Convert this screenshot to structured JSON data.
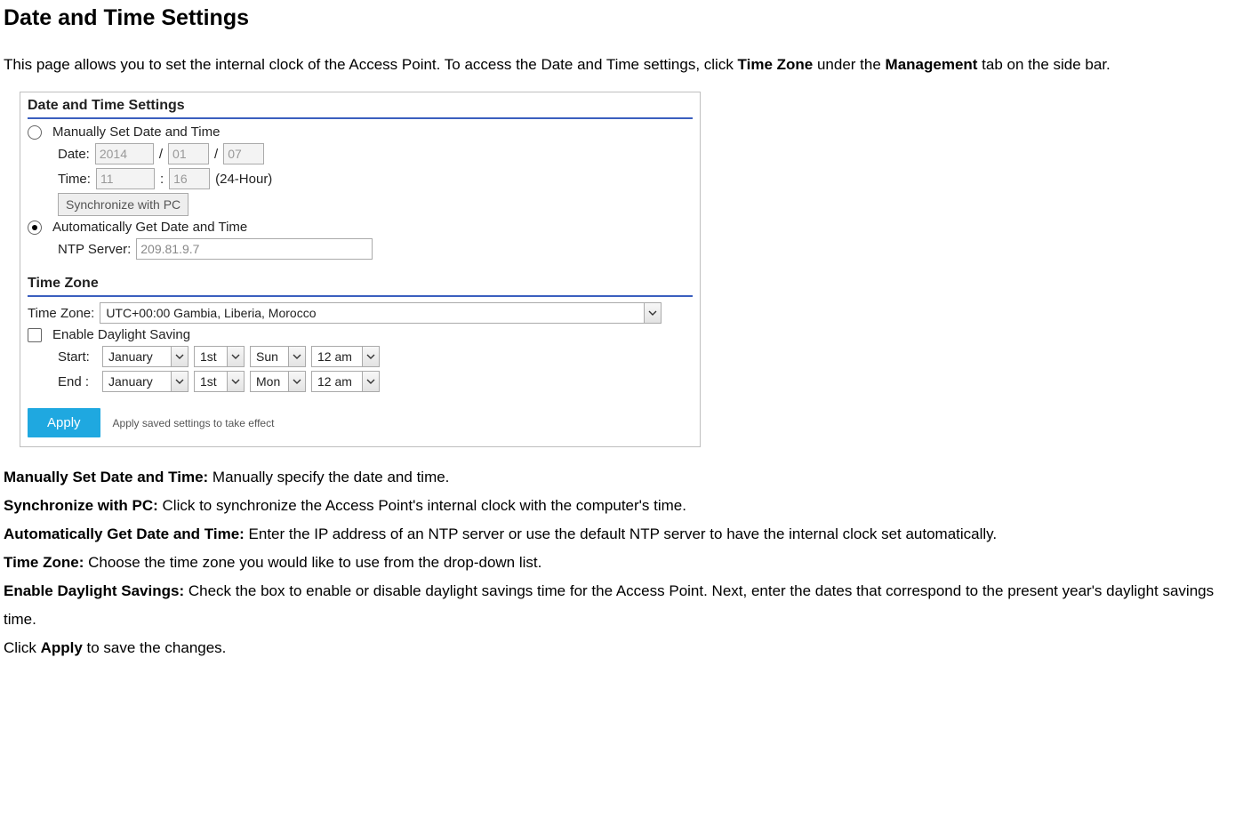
{
  "page": {
    "title": "Date and Time Settings",
    "intro_pre": "This page allows you to set the internal clock of the Access Point. To access the Date and Time settings, click ",
    "intro_tz": "Time Zone",
    "intro_mid": " under the ",
    "intro_mgmt": "Management",
    "intro_post": " tab on the side bar."
  },
  "panel": {
    "section1_title": "Date and Time Settings",
    "manual_label": "Manually Set Date and Time",
    "date_label": "Date:",
    "date_year": "2014",
    "date_month": "01",
    "date_day": "07",
    "slash": "/",
    "time_label": "Time:",
    "time_h": "11",
    "time_m": "16",
    "colon": ":",
    "hour_note": "(24-Hour)",
    "sync_btn": "Synchronize with PC",
    "auto_label": "Automatically Get Date and Time",
    "ntp_label": "NTP Server:",
    "ntp_value": "209.81.9.7",
    "section2_title": "Time Zone",
    "tz_label": "Time Zone:",
    "tz_value": "UTC+00:00 Gambia, Liberia, Morocco",
    "dst_label": "Enable Daylight Saving",
    "start_label": "Start:",
    "end_label": "End :",
    "start": {
      "month": "January",
      "day": "1st",
      "dow": "Sun",
      "hour": "12 am"
    },
    "end": {
      "month": "January",
      "day": "1st",
      "dow": "Mon",
      "hour": "12 am"
    },
    "apply_btn": "Apply",
    "apply_note": "Apply saved settings to take effect"
  },
  "desc": {
    "l1_b": "Manually Set Date and Time:",
    "l1_t": " Manually specify the date and time.",
    "l2_b": "Synchronize with PC:",
    "l2_t": " Click to synchronize the Access Point's internal clock with the computer's time.",
    "l3_b": "Automatically Get Date and Time:",
    "l3_t": " Enter the IP address of an NTP server or use the default NTP server to have the internal clock set automatically.",
    "l4_b": "Time Zone:",
    "l4_t": " Choose the time zone you would like to use from the drop-down list.",
    "l5_b": "Enable Daylight Savings:",
    "l5_t": " Check the box to enable or disable daylight savings time for the Access Point. Next, enter the dates that correspond to the present year's daylight savings time.",
    "l6_pre": "Click ",
    "l6_b": "Apply",
    "l6_post": " to save the changes."
  }
}
